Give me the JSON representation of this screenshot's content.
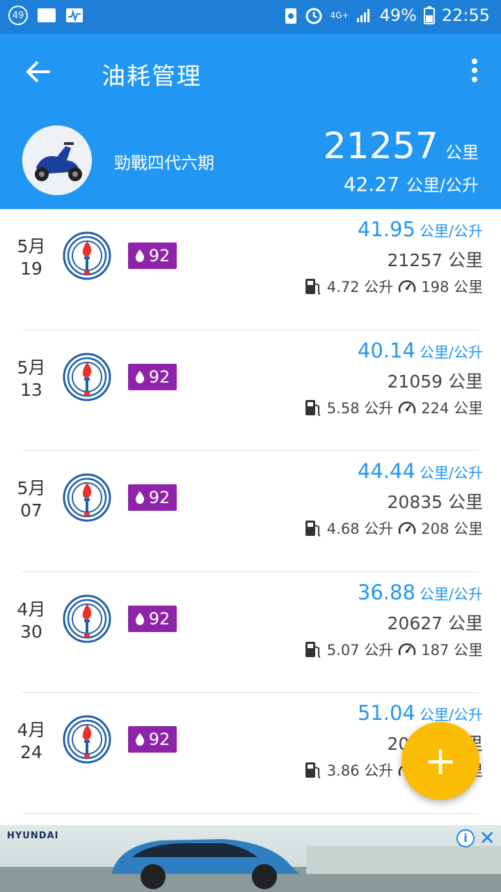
{
  "status": {
    "notification_count": "49",
    "network": "4G+",
    "battery": "49%",
    "time": "22:55"
  },
  "header": {
    "title": "油耗管理",
    "vehicle_name": "勁戰四代六期",
    "total_distance": "21257",
    "distance_unit": "公里",
    "avg_efficiency": "42.27",
    "efficiency_unit": "公里/公升"
  },
  "records": [
    {
      "month": "5月",
      "day": "19",
      "octane": "92",
      "efficiency": "41.95",
      "efficiency_unit": "公里/公升",
      "odometer": "21257 公里",
      "fuel": "4.72 公升",
      "trip": "198 公里"
    },
    {
      "month": "5月",
      "day": "13",
      "octane": "92",
      "efficiency": "40.14",
      "efficiency_unit": "公里/公升",
      "odometer": "21059 公里",
      "fuel": "5.58 公升",
      "trip": "224 公里"
    },
    {
      "month": "5月",
      "day": "07",
      "octane": "92",
      "efficiency": "44.44",
      "efficiency_unit": "公里/公升",
      "odometer": "20835 公里",
      "fuel": "4.68 公升",
      "trip": "208 公里"
    },
    {
      "month": "4月",
      "day": "30",
      "octane": "92",
      "efficiency": "36.88",
      "efficiency_unit": "公里/公升",
      "odometer": "20627 公里",
      "fuel": "5.07 公升",
      "trip": "187 公里"
    },
    {
      "month": "4月",
      "day": "24",
      "octane": "92",
      "efficiency": "51.04",
      "efficiency_unit": "公里/公升",
      "odometer": "20419 公里",
      "fuel": "3.86 公升",
      "trip": "208 公里"
    }
  ],
  "fab": {
    "label": "+"
  },
  "ad": {
    "brand": "HYUNDAI",
    "info": "i",
    "close": "✕"
  },
  "colors": {
    "primary": "#2196f3",
    "statusbar": "#1e7fd8",
    "badge": "#8e24aa",
    "fab": "#fbbc05"
  }
}
